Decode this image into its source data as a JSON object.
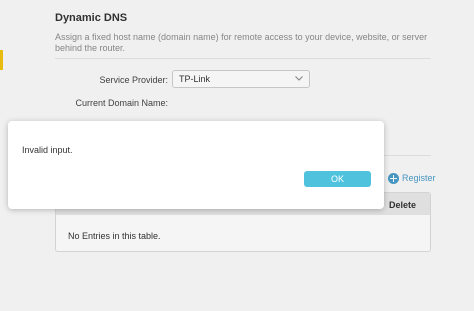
{
  "page": {
    "title": "Dynamic DNS",
    "description": "Assign a fixed host name (domain name) for remote access to your device, website, or server behind the router."
  },
  "form": {
    "service_provider_label": "Service Provider:",
    "service_provider_value": "TP-Link",
    "current_domain_label": "Current Domain Name:"
  },
  "actions": {
    "register_label": "Register"
  },
  "table": {
    "delete_header": "Delete",
    "empty_message": "No Entries in this table."
  },
  "dialog": {
    "message": "Invalid input.",
    "ok_label": "OK"
  },
  "colors": {
    "accent": "#4fc3dd",
    "link": "#4a9dc9"
  },
  "icons": {
    "dropdown": "chevron-down-icon",
    "register": "plus-circle-icon"
  }
}
